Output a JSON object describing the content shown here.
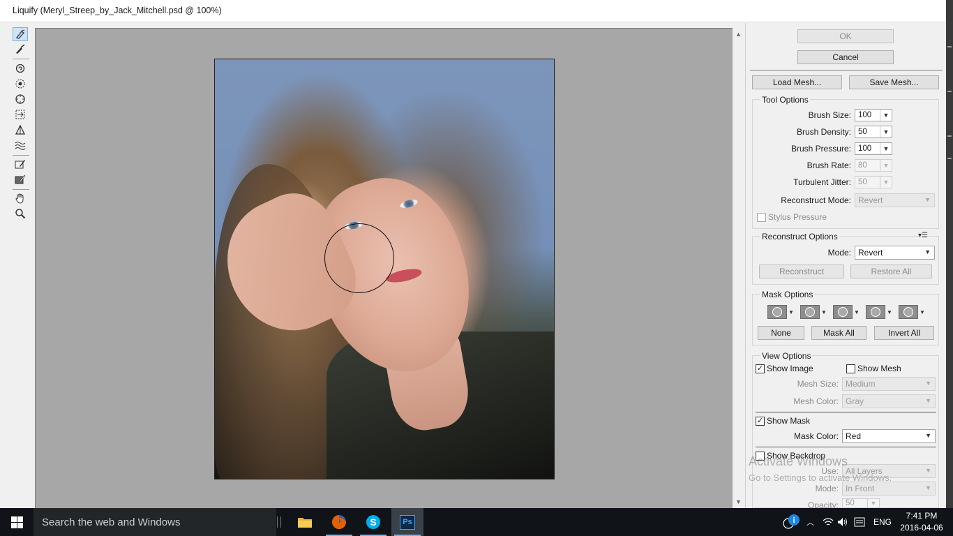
{
  "window": {
    "title": "Liquify (Meryl_Streep_by_Jack_Mitchell.psd @ 100%)"
  },
  "toolbar": {
    "tools": [
      {
        "name": "forward-warp-tool",
        "active": true
      },
      {
        "name": "reconstruct-tool"
      },
      {
        "name": "twirl-clockwise-tool"
      },
      {
        "name": "pucker-tool"
      },
      {
        "name": "bloat-tool"
      },
      {
        "name": "push-left-tool"
      },
      {
        "name": "mirror-tool"
      },
      {
        "name": "turbulence-tool"
      },
      {
        "name": "freeze-mask-tool"
      },
      {
        "name": "thaw-mask-tool"
      },
      {
        "name": "hand-tool"
      },
      {
        "name": "zoom-tool"
      }
    ]
  },
  "panel": {
    "ok": "OK",
    "cancel": "Cancel",
    "load_mesh": "Load Mesh...",
    "save_mesh": "Save Mesh...",
    "tool_options": {
      "title": "Tool Options",
      "brush_size_label": "Brush Size:",
      "brush_size": "100",
      "brush_density_label": "Brush Density:",
      "brush_density": "50",
      "brush_pressure_label": "Brush Pressure:",
      "brush_pressure": "100",
      "brush_rate_label": "Brush Rate:",
      "brush_rate": "80",
      "turbulent_jitter_label": "Turbulent Jitter:",
      "turbulent_jitter": "50",
      "reconstruct_mode_label": "Reconstruct Mode:",
      "reconstruct_mode": "Revert",
      "stylus_pressure": "Stylus Pressure"
    },
    "reconstruct_options": {
      "title": "Reconstruct Options",
      "mode_label": "Mode:",
      "mode": "Revert",
      "reconstruct": "Reconstruct",
      "restore_all": "Restore All"
    },
    "mask_options": {
      "title": "Mask Options",
      "none": "None",
      "mask_all": "Mask All",
      "invert_all": "Invert All"
    },
    "view_options": {
      "title": "View Options",
      "show_image": "Show Image",
      "show_mesh": "Show Mesh",
      "mesh_size_label": "Mesh Size:",
      "mesh_size": "Medium",
      "mesh_color_label": "Mesh Color:",
      "mesh_color": "Gray",
      "show_mask": "Show Mask",
      "mask_color_label": "Mask Color:",
      "mask_color": "Red",
      "show_backdrop": "Show Backdrop",
      "use_label": "Use:",
      "use": "All Layers",
      "mode_label": "Mode:",
      "mode": "In Front",
      "opacity_label": "Opacity:",
      "opacity": "50"
    }
  },
  "watermark": {
    "line1": "Activate Windows",
    "line2": "Go to Settings to activate Windows."
  },
  "taskbar": {
    "search_placeholder": "Search the web and Windows",
    "apps": [
      "file-explorer",
      "firefox",
      "skype",
      "photoshop"
    ],
    "photoshop_label": "Ps",
    "language": "ENG",
    "time": "7:41 PM",
    "date": "2016-04-06"
  },
  "colors": {
    "canvas_bg": "#a7a7a7",
    "panel_bg": "#f0f0f0",
    "taskbar_bg": "#101418",
    "accent": "#7fb0e0"
  }
}
